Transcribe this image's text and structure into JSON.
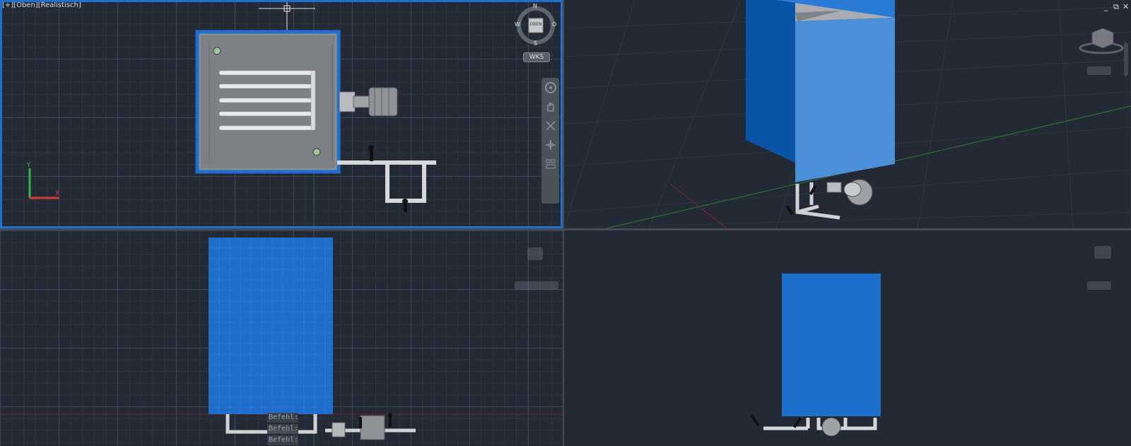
{
  "viewports": {
    "top_left": {
      "label": "[+][Oben][Realistisch]",
      "viewcube_face": "OBEN",
      "compass": {
        "n": "N",
        "s": "S",
        "w": "W",
        "o": "O"
      },
      "wcs_button": "WKS"
    },
    "top_right": {
      "window_controls": {
        "minimize": "_",
        "restore": "⧉",
        "close": "✕"
      }
    },
    "bottom_left": {
      "command_lines": [
        "Befehl:",
        "Befehl:",
        "Befehl:"
      ]
    }
  },
  "navigation_bar": {
    "items": [
      "full-navigation-wheel-icon",
      "pan-icon",
      "zoom-icon",
      "orbit-icon",
      "showmotion-icon"
    ]
  },
  "colors": {
    "viewport_bg": "#232a35",
    "active_border": "#1f6fd1",
    "tank_blue": "#1e6fcc",
    "tank_top_blue": "#2b7bd6",
    "pipe_gray": "#c9cdd1",
    "x_axis": "#d23a3a",
    "y_axis": "#37b34a"
  }
}
